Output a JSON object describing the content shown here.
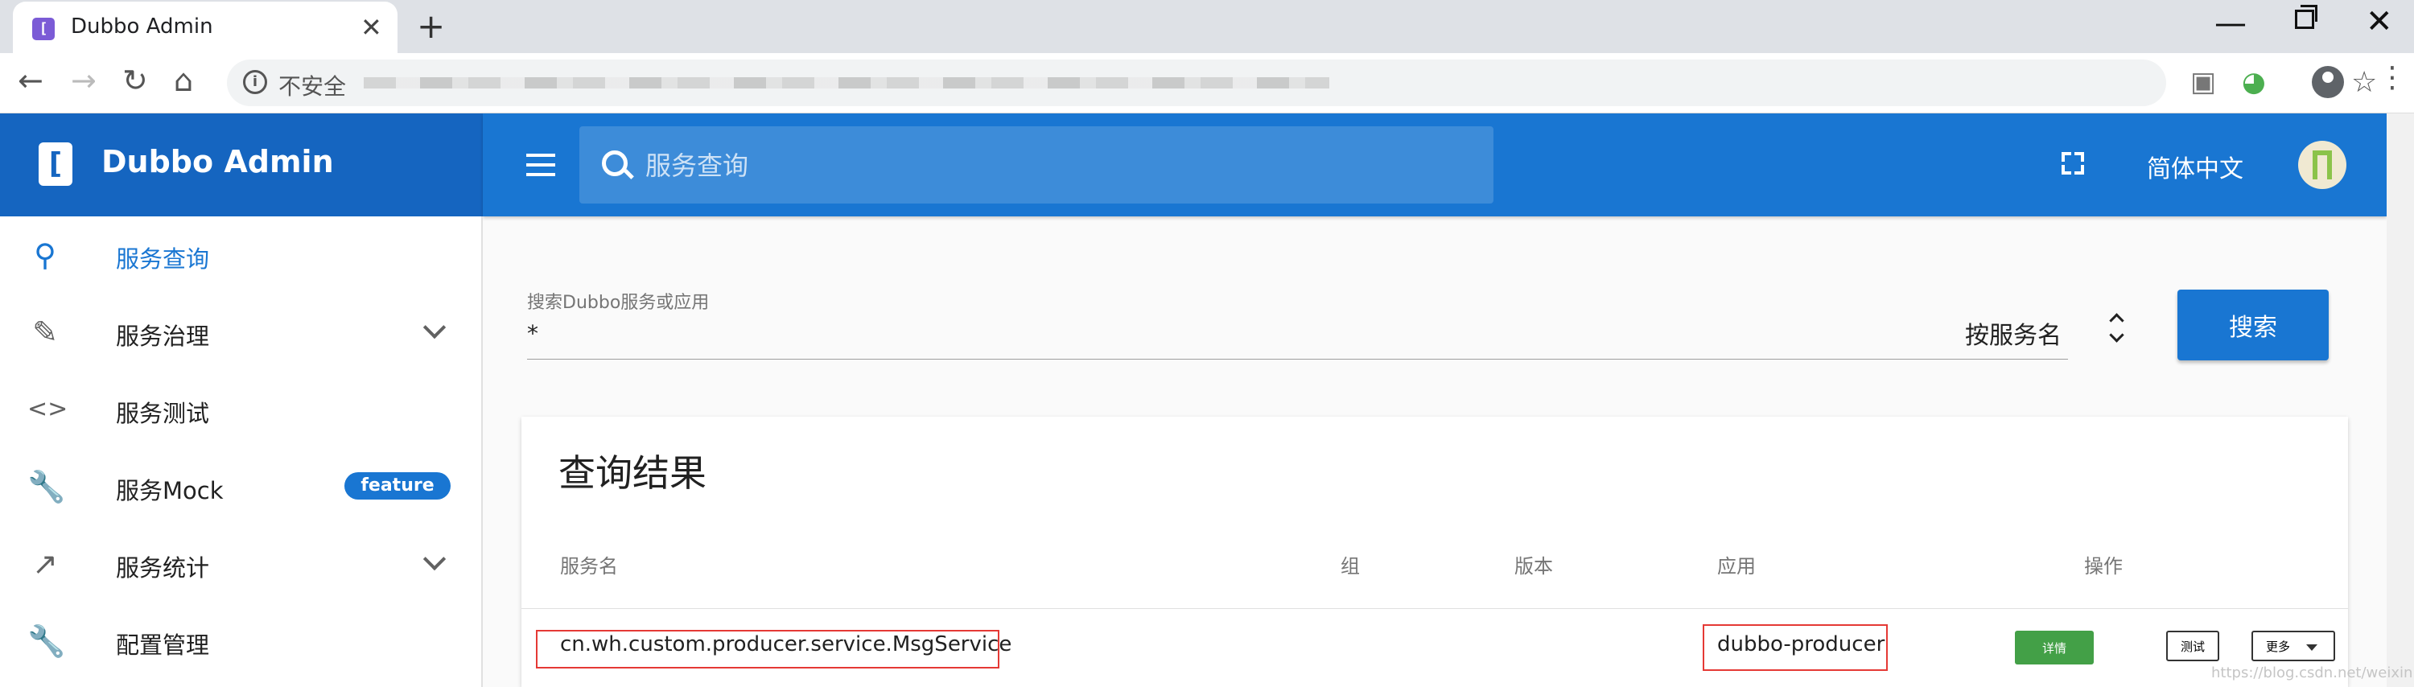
{
  "browser": {
    "tab_favicon_letter": "[",
    "tab_title": "Dubbo Admin",
    "tab_close": "✕",
    "new_tab": "+",
    "window_minimize": "—",
    "window_close": "✕",
    "security_label": "不安全"
  },
  "header": {
    "logo_letter": "[",
    "app_name": "Dubbo Admin",
    "search_placeholder": "服务查询",
    "language": "简体中文",
    "primary_color": "#1976d2",
    "logo_bar_color": "#1565c0"
  },
  "sidebar": {
    "items": [
      {
        "label": "服务查询",
        "icon": "search-icon",
        "active": true
      },
      {
        "label": "服务治理",
        "icon": "pencil-icon",
        "expandable": true
      },
      {
        "label": "服务测试",
        "icon": "code-icon"
      },
      {
        "label": "服务Mock",
        "icon": "wrench-icon",
        "badge": "feature"
      },
      {
        "label": "服务统计",
        "icon": "trending-icon",
        "expandable": true
      },
      {
        "label": "配置管理",
        "icon": "wrench-icon"
      }
    ]
  },
  "search": {
    "label": "搜索Dubbo服务或应用",
    "value": "*",
    "type_selected": "按服务名",
    "button_label": "搜索"
  },
  "results": {
    "title": "查询结果",
    "columns": [
      "服务名",
      "组",
      "版本",
      "应用",
      "操作"
    ],
    "rows": [
      {
        "service": "cn.wh.custom.producer.service.MsgService",
        "group": "",
        "version": "",
        "application": "dubbo-producer",
        "actions": {
          "detail": "详情",
          "test": "测试",
          "more": "更多"
        }
      }
    ],
    "detail_color": "#43a047",
    "highlight_color": "#e53935"
  },
  "watermark": "https://blog.csdn.net/weixin"
}
